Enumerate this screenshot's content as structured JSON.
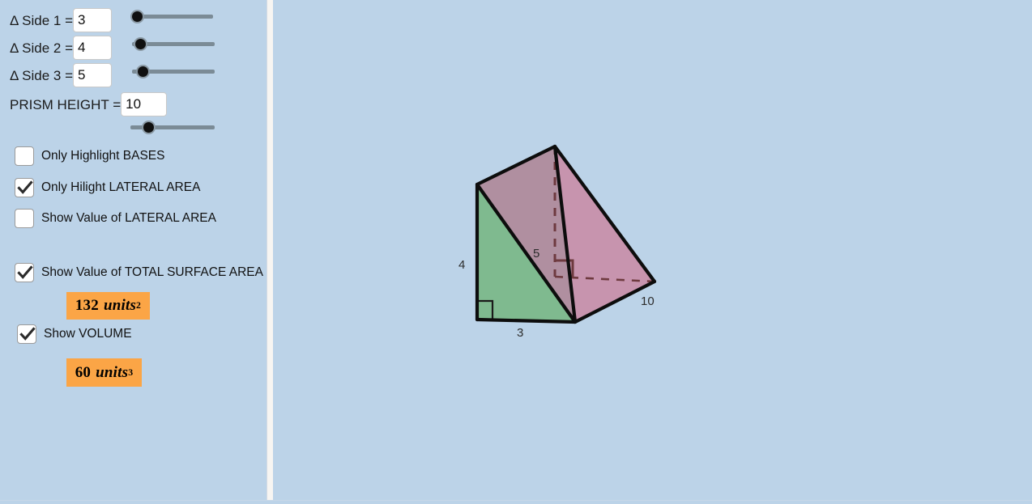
{
  "colors": {
    "background": "#bcd3e8",
    "panel_divider": "#f7f5f2",
    "badge_orange": "#fba546",
    "face_front_green": "#7fba8f",
    "face_top_mauve": "#b08fa0",
    "face_right_pink": "#c794ae",
    "face_bottom_gray": "#7f919c",
    "edge_black": "#0d0d0d",
    "hidden_edge_maroon": "#6e3a3f",
    "slider_track": "#7b8b96",
    "slider_knob": "#101010"
  },
  "sliders": [
    {
      "label": "Δ Side 1 =",
      "value": "3",
      "knob_pct": 2
    },
    {
      "label": "Δ Side 2 =",
      "value": "4",
      "knob_pct": 7
    },
    {
      "label": "Δ Side 3 =",
      "value": "5",
      "knob_pct": 9
    },
    {
      "label": "PRISM HEIGHT =",
      "value": "10",
      "knob_pct": 21
    }
  ],
  "checkboxes": [
    {
      "label": "Only Highlight BASES",
      "checked": false
    },
    {
      "label": "Only Hilight LATERAL AREA",
      "checked": true
    },
    {
      "label": "Show Value of LATERAL AREA",
      "checked": false
    },
    {
      "label": "Show Value of TOTAL SURFACE AREA",
      "checked": true
    },
    {
      "label": "Show VOLUME",
      "checked": true
    }
  ],
  "values": {
    "total_surface_area": {
      "number": "132",
      "unit": "units",
      "exponent": "2"
    },
    "volume": {
      "number": "60",
      "unit": "units",
      "exponent": "3"
    }
  },
  "figure": {
    "labels": {
      "side_4": "4",
      "side_5": "5",
      "side_3": "3",
      "height_10": "10"
    }
  },
  "chart_data": {
    "type": "diagram",
    "title": "Triangular Prism",
    "shape": "right triangular prism",
    "triangle_sides": {
      "side1": 3,
      "side2": 4,
      "side3": 5
    },
    "prism_height": 10,
    "total_surface_area": 132,
    "volume": 60,
    "units": {
      "area": "units^2",
      "volume": "units^3"
    },
    "annotations": [
      "4",
      "5",
      "3",
      "10"
    ],
    "faces": [
      {
        "name": "front-triangle-base",
        "color": "#7fba8f"
      },
      {
        "name": "top-lateral-face",
        "color": "#b08fa0"
      },
      {
        "name": "right-lateral-face",
        "color": "#c794ae"
      },
      {
        "name": "bottom-lateral-face",
        "color": "#7f919c"
      }
    ]
  }
}
